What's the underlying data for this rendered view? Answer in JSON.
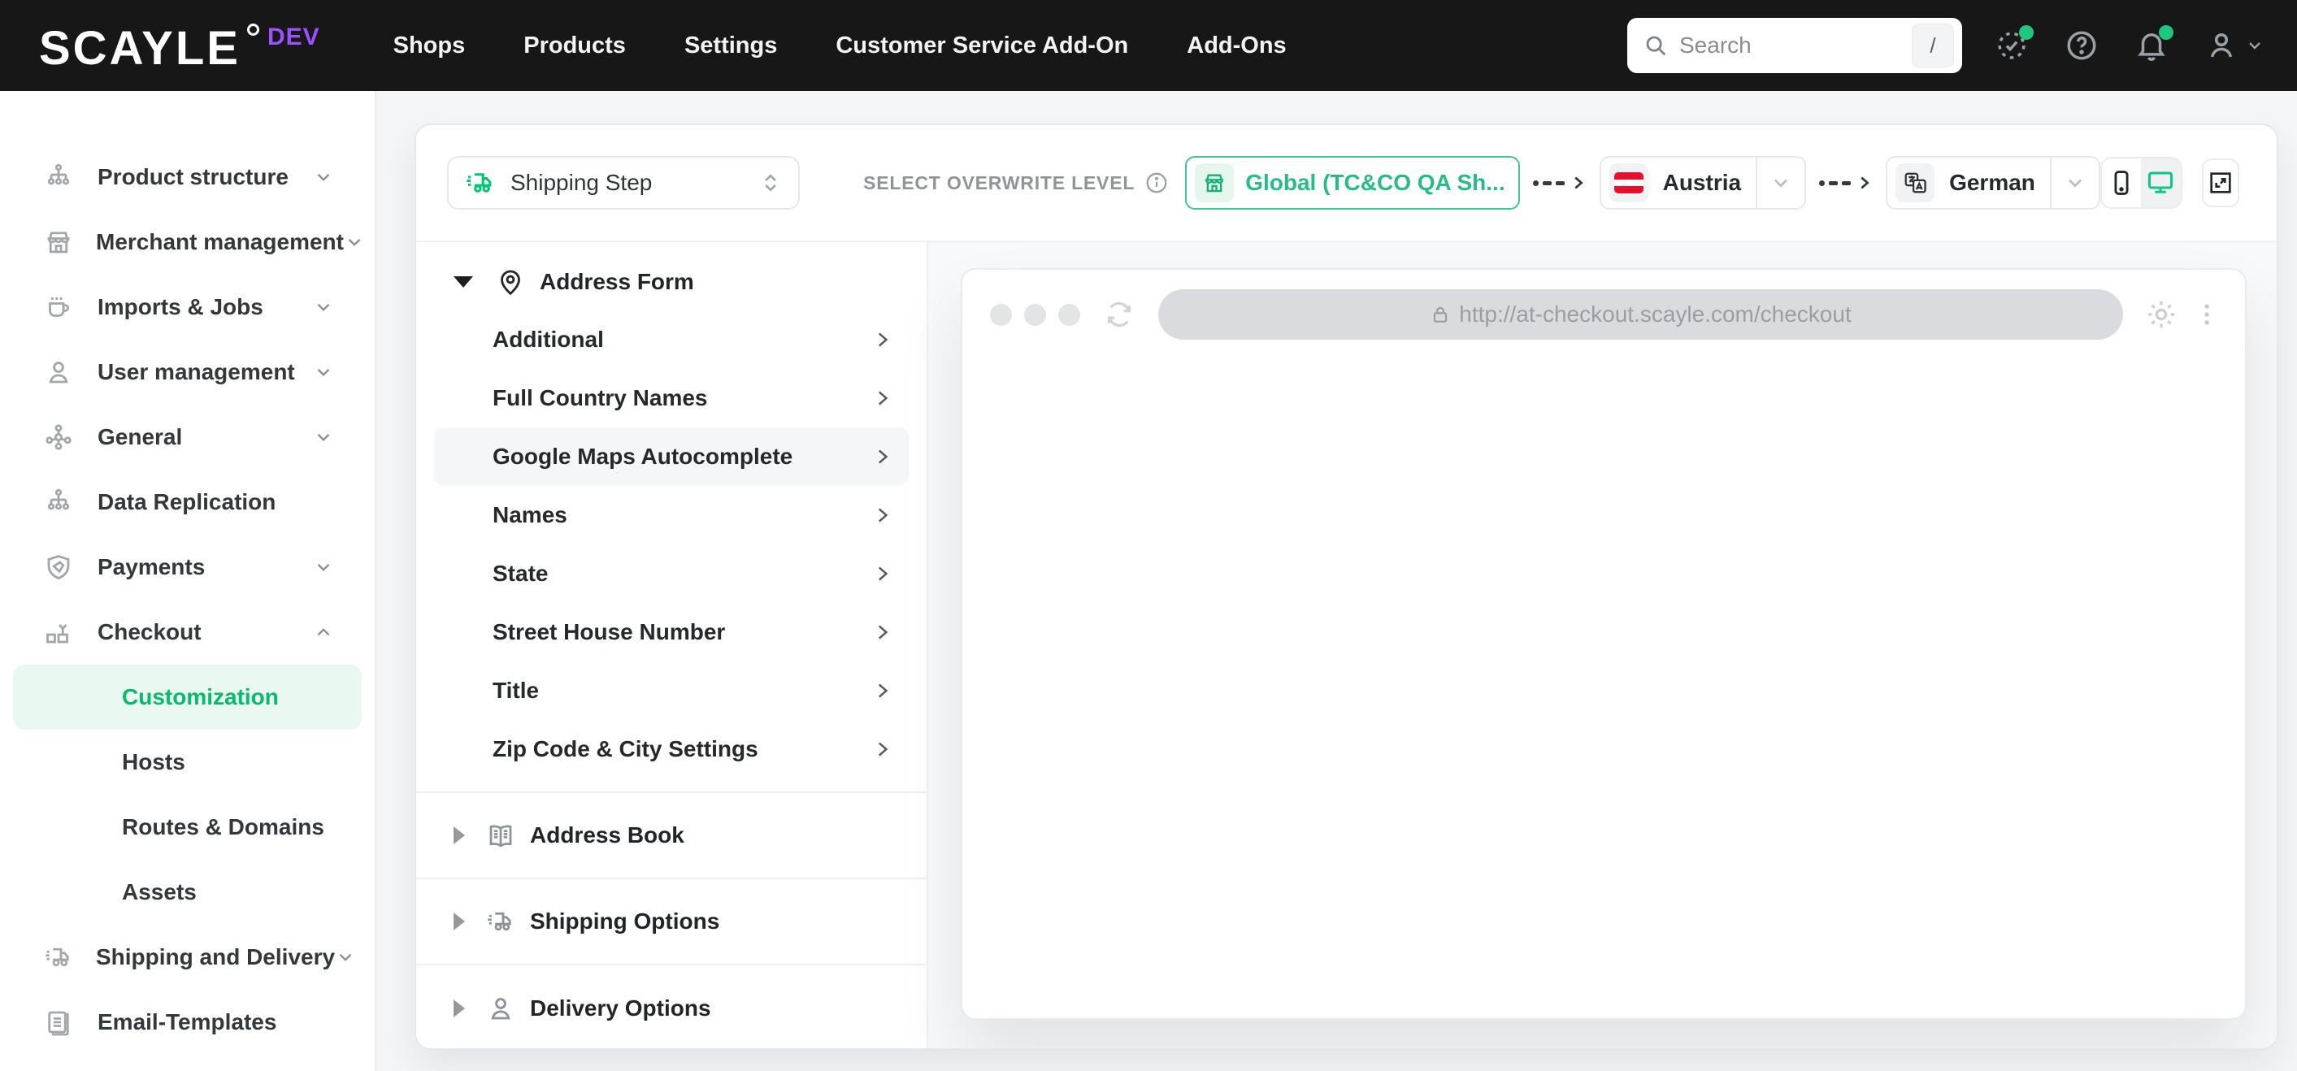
{
  "topbar": {
    "logo": "SCAYLE",
    "env_badge": "DEV",
    "nav": [
      {
        "label": "Shops"
      },
      {
        "label": "Products"
      },
      {
        "label": "Settings"
      },
      {
        "label": "Customer Service Add-On"
      },
      {
        "label": "Add-Ons"
      }
    ],
    "search": {
      "placeholder": "Search",
      "shortcut_key": "/"
    }
  },
  "sidebar": {
    "items": [
      {
        "label": "Product structure"
      },
      {
        "label": "Merchant management"
      },
      {
        "label": "Imports & Jobs"
      },
      {
        "label": "User management"
      },
      {
        "label": "General"
      },
      {
        "label": "Data Replication"
      },
      {
        "label": "Payments"
      },
      {
        "label": "Checkout"
      },
      {
        "label": "Customization"
      },
      {
        "label": "Hosts"
      },
      {
        "label": "Routes & Domains"
      },
      {
        "label": "Assets"
      },
      {
        "label": "Shipping and Delivery"
      },
      {
        "label": "Email-Templates"
      }
    ],
    "selected_item": "Customization"
  },
  "toolbar": {
    "step_selector_value": "Shipping Step",
    "overwrite_label": "SELECT OVERWRITE LEVEL",
    "level_button_label": "Global (TC&CO QA Sh...",
    "country_value": "Austria",
    "language_value": "German"
  },
  "tree": {
    "sections": [
      {
        "title": "Address Form",
        "items": [
          {
            "label": "Additional"
          },
          {
            "label": "Full Country Names"
          },
          {
            "label": "Google Maps Autocomplete"
          },
          {
            "label": "Names"
          },
          {
            "label": "State"
          },
          {
            "label": "Street House Number"
          },
          {
            "label": "Title"
          },
          {
            "label": "Zip Code & City Settings"
          }
        ],
        "selected_item": "Google Maps Autocomplete"
      },
      {
        "title": "Address Book"
      },
      {
        "title": "Shipping Options"
      },
      {
        "title": "Delivery Options"
      }
    ]
  },
  "preview": {
    "url": "http://at-checkout.scayle.com/checkout"
  },
  "colors": {
    "accent_green": "#09ba6e",
    "level_green": "#28bc85",
    "badge_purple": "#9b51ff",
    "notification_green": "#1cc87e",
    "topbar_black": "#171717",
    "selected_row_mint": "#e9f8f0"
  }
}
